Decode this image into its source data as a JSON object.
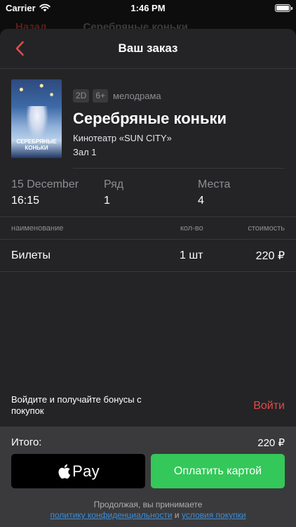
{
  "status": {
    "carrier": "Carrier",
    "time": "1:46 PM"
  },
  "behind": {
    "left": "Назад",
    "title": "Серебряные коньки"
  },
  "nav": {
    "title": "Ваш заказ"
  },
  "movie": {
    "format": "2D",
    "age": "6+",
    "genre": "мелодрама",
    "title": "Серебряные коньки",
    "cinema": "Кинотеатр «SUN CITY»",
    "hall": "Зал 1",
    "poster_title": "Серебряные коньки"
  },
  "details": {
    "date": "15 December",
    "time": "16:15",
    "row_label": "Ряд",
    "row_value": "1",
    "seats_label": "Места",
    "seats_value": "4"
  },
  "table": {
    "headers": {
      "name": "наименование",
      "qty": "кол-во",
      "cost": "стоимость"
    },
    "rows": [
      {
        "name": "Билеты",
        "qty": "1 шт",
        "cost": "220 ₽"
      }
    ]
  },
  "bonus": {
    "text": "Войдите и получайте бонусы с покупок",
    "login": "Войти"
  },
  "footer": {
    "total_label": "Итого:",
    "total_value": "220 ₽",
    "apple_pay_label": "Pay",
    "card_pay_label": "Оплатить картой",
    "terms_prefix": "Продолжая, вы принимаете",
    "privacy_link": "политику конфиденциальности",
    "and": "и",
    "terms_link": "условия покупки"
  },
  "colors": {
    "accent": "#e34a4a",
    "pay_green": "#34c759",
    "link": "#3b8fd9"
  }
}
